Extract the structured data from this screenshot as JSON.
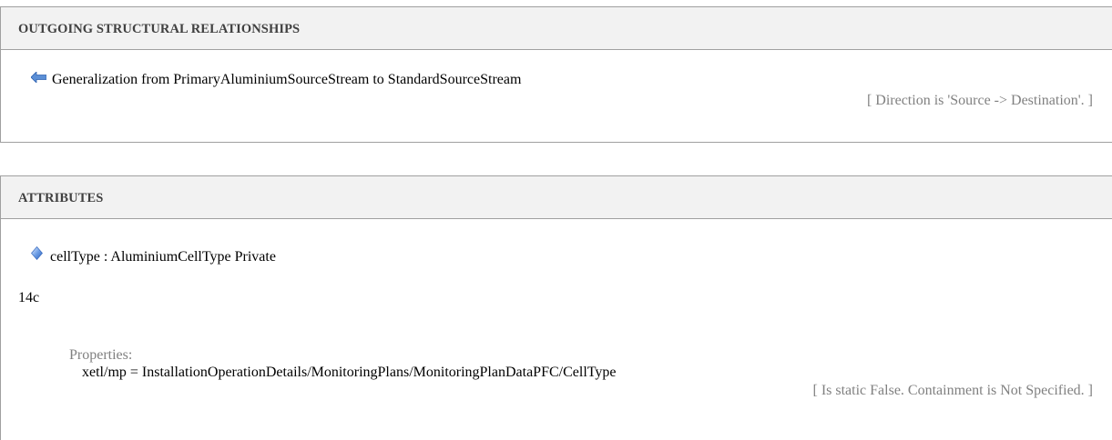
{
  "outgoing": {
    "title": "OUTGOING STRUCTURAL RELATIONSHIPS",
    "relation_icon": "arrow-left-icon",
    "relation_text": "Generalization from  PrimaryAluminiumSourceStream to  StandardSourceStream",
    "direction_note": "[ Direction is 'Source -> Destination'. ]"
  },
  "attributes": {
    "title": "ATTRIBUTES",
    "attribute_icon": "attribute-diamond-icon",
    "attribute_text": "cellType : AluminiumCellType  Private",
    "note": "14c",
    "properties_label": "Properties:",
    "property_value": "xetl/mp = InstallationOperationDetails/MonitoringPlans/MonitoringPlanDataPFC/CellType",
    "static_note": "[ Is static False. Containment is Not Specified. ]"
  },
  "colors": {
    "header_bg": "#f2f2f2",
    "border": "#a0a0a0",
    "muted_text": "#808080",
    "arrow_icon": "#5b8fd6"
  }
}
